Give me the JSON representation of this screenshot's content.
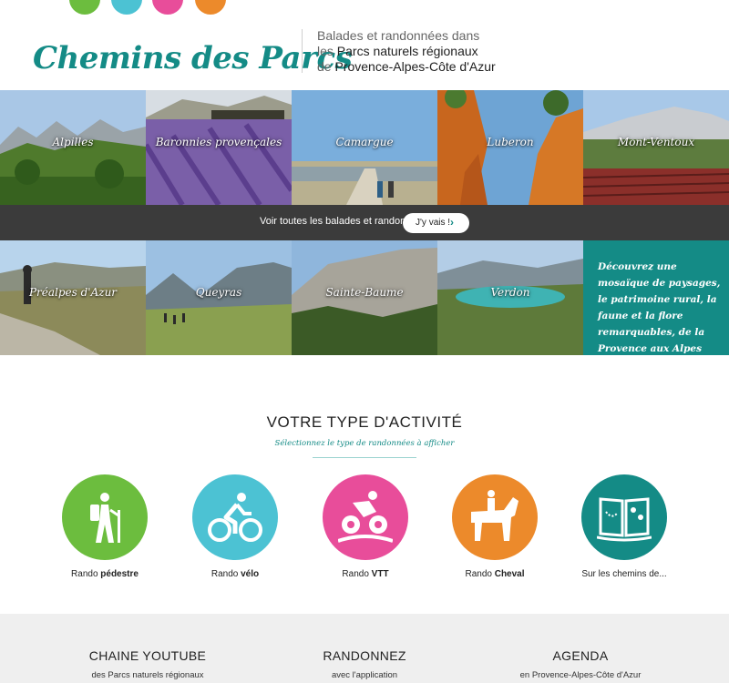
{
  "colors": {
    "teal": "#148b86",
    "green": "#6cbd3e",
    "cyan": "#4cc2d3",
    "pink": "#e84d9a",
    "orange": "#ec8a2b",
    "banner": "#3b3b3b",
    "footer_bg": "#efefef"
  },
  "header": {
    "logo": "Chemins des Parcs",
    "tagline_line1": "Balades et randonnées dans",
    "tagline_line2_prefix": "les ",
    "tagline_line2_strong": "Parcs naturels régionaux",
    "tagline_line3_prefix": "de ",
    "tagline_line3_strong": "Provence-Alpes-Côte d'Azur"
  },
  "parks_row1": [
    "Alpilles",
    "Baronnies provençales",
    "Camargue",
    "Luberon",
    "Mont-Ventoux"
  ],
  "banner": {
    "text": "Voir toutes les balades et randonnées",
    "button": "J'y vais !"
  },
  "parks_row2": [
    "Préalpes d'Azur",
    "Queyras",
    "Sainte-Baume",
    "Verdon"
  ],
  "discover_blurb": "Découvrez une mosaïque de paysages, le patrimoine rural, la faune et la flore remarquables, de la Provence aux Alpes",
  "activities": {
    "title": "VOTRE TYPE D'ACTIVITÉ",
    "subtitle": "Sélectionnez le type de randonnées à afficher",
    "items": [
      {
        "prefix": "Rando ",
        "strong": "pédestre",
        "icon": "hiker-icon"
      },
      {
        "prefix": "Rando ",
        "strong": "vélo",
        "icon": "bike-icon"
      },
      {
        "prefix": "Rando ",
        "strong": "VTT",
        "icon": "mountain-bike-icon"
      },
      {
        "prefix": "Rando ",
        "strong": "Cheval",
        "icon": "horse-rider-icon"
      },
      {
        "prefix": "Sur les chemins de...",
        "strong": "",
        "icon": "book-map-icon"
      }
    ]
  },
  "footer": [
    {
      "heading": "CHAINE YOUTUBE",
      "sub": "des Parcs naturels régionaux"
    },
    {
      "heading": "RANDONNEZ",
      "sub": "avec l'application"
    },
    {
      "heading": "AGENDA",
      "sub": "en Provence-Alpes-Côte d'Azur"
    }
  ]
}
